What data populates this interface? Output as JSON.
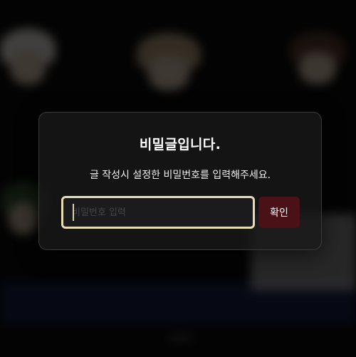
{
  "dialog": {
    "title": "비밀글입니다.",
    "message": "글 작성시 설정한 비밀번호를 입력해주세요.",
    "password_placeholder": "비밀번호 입력",
    "confirm_label": "확인"
  },
  "colors": {
    "input_border": "#e8ddb0",
    "confirm_bg": "#4a1216",
    "modal_bg": "#1a1a1a"
  }
}
